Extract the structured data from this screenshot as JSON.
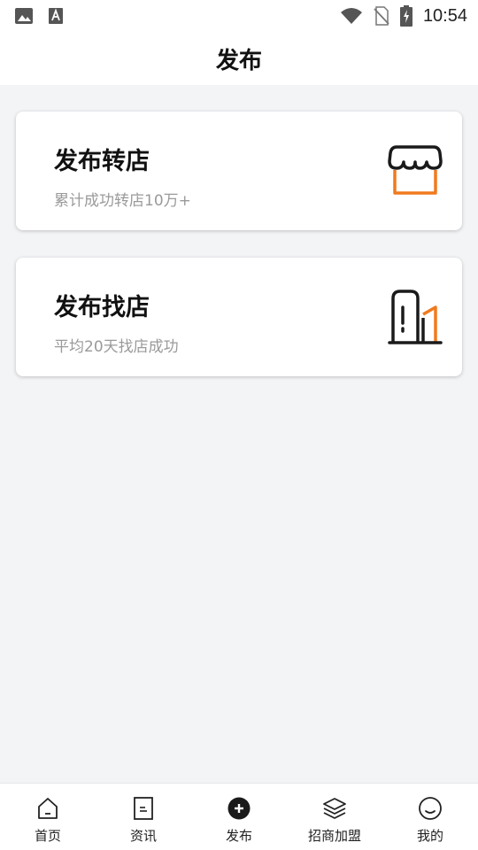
{
  "status_bar": {
    "time": "10:54",
    "left_icons": [
      "image-icon",
      "font-icon"
    ],
    "right_icons": [
      "wifi-icon",
      "no-sim-icon",
      "battery-charging-icon"
    ]
  },
  "header": {
    "title": "发布"
  },
  "cards": [
    {
      "title": "发布转店",
      "subtitle": "累计成功转店10万+",
      "icon": "shop-icon"
    },
    {
      "title": "发布找店",
      "subtitle": "平均20天找店成功",
      "icon": "building-icon"
    }
  ],
  "tab_bar": {
    "items": [
      {
        "label": "首页",
        "icon": "home-icon"
      },
      {
        "label": "资讯",
        "icon": "document-icon"
      },
      {
        "label": "发布",
        "icon": "plus-circle-icon"
      },
      {
        "label": "招商加盟",
        "icon": "layers-icon"
      },
      {
        "label": "我的",
        "icon": "smile-icon"
      }
    ]
  },
  "colors": {
    "accent": "#f07a1e",
    "background": "#f3f4f6",
    "text": "#111111",
    "subtext": "#9a9a9a"
  }
}
